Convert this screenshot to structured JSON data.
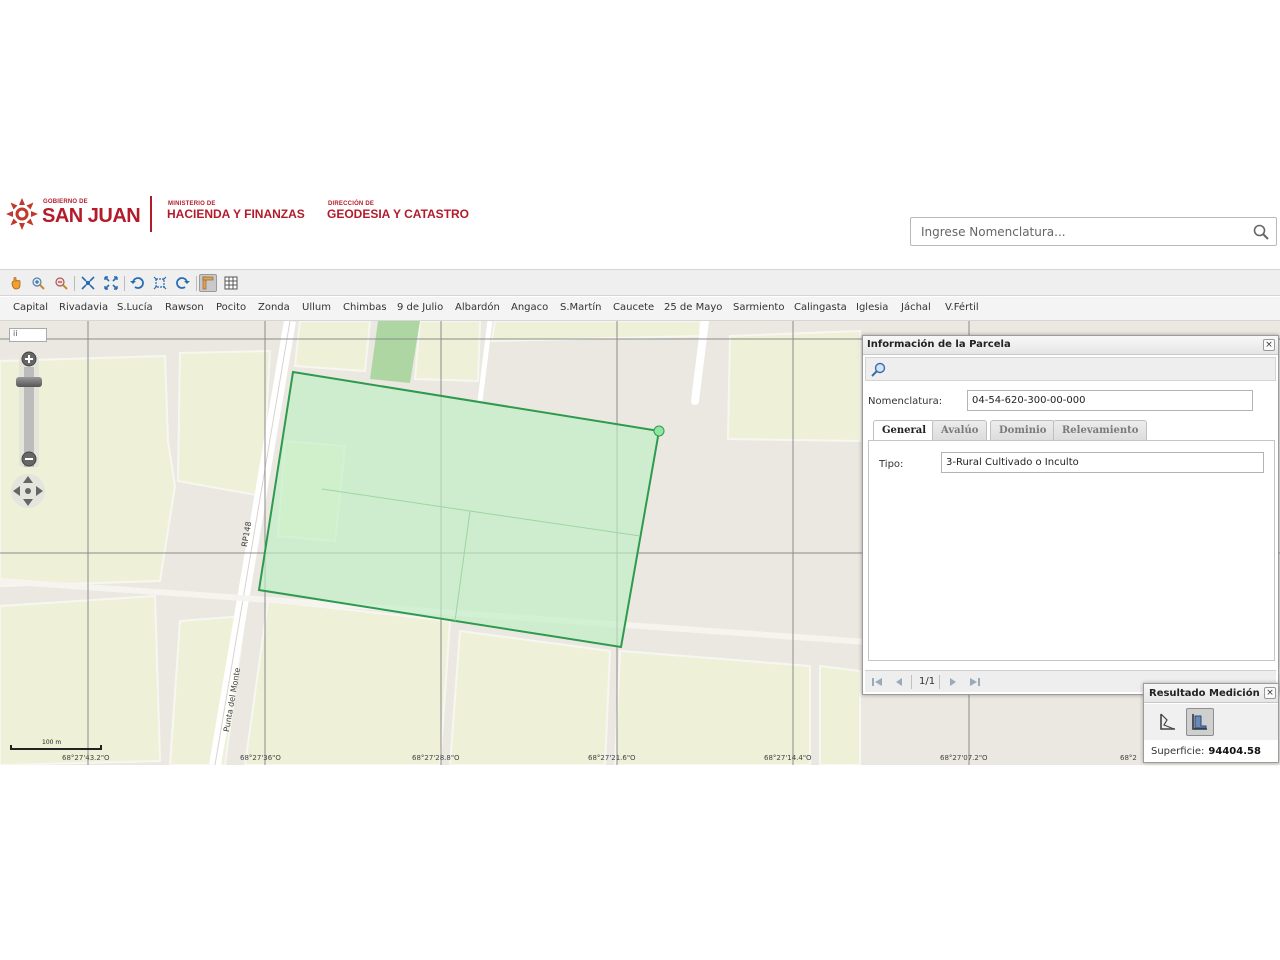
{
  "header": {
    "gov_small": "GOBIERNO DE",
    "gov_big": "SAN JUAN",
    "ministry_small": "MINISTERIO DE",
    "ministry_big": "HACIENDA Y FINANZAS",
    "direction_small": "DIRECCIÓN DE",
    "direction_big": "GEODESIA Y CATASTRO",
    "brand_color": "#b31b2b"
  },
  "search": {
    "placeholder": "Ingrese Nomenclatura...",
    "value": ""
  },
  "toolbar": {
    "icons": [
      "pan-hand-icon",
      "zoom-in-icon",
      "zoom-out-icon",
      "zoom-extent-icon",
      "zoom-full-icon",
      "undo-icon",
      "select-box-icon",
      "redo-icon",
      "measure-icon",
      "grid-icon"
    ]
  },
  "departments": [
    "Capital",
    "Rivadavia",
    "S.Lucía",
    "Rawson",
    "Pocito",
    "Zonda",
    "Ullum",
    "Chimbas",
    "9 de Julio",
    "Albardón",
    "Angaco",
    "S.Martín",
    "Caucete",
    "25 de Mayo",
    "Sarmiento",
    "Calingasta",
    "Iglesia",
    "Jáchal",
    "V.Fértil"
  ],
  "map": {
    "zoom_level": "ii",
    "road_label_1": "RP148",
    "road_label_2": "Punta del Monte",
    "scale_label": "100 m",
    "coordinates": [
      "68°27'43.2\"O",
      "68°27'36\"O",
      "68°27'28.8\"O",
      "68°27'21.6\"O",
      "68°27'14.4\"O",
      "68°27'07.2\"O",
      "68°2"
    ],
    "parcel_color": "#2e9a4e",
    "parcel_fill": "#bff0c4"
  },
  "info_panel": {
    "title": "Información de la Parcela",
    "close": "×",
    "nomenclatura_label": "Nomenclatura:",
    "nomenclatura_value": "04-54-620-300-00-000",
    "tabs": [
      "General",
      "Avalúo",
      "Dominio",
      "Relevamiento"
    ],
    "active_tab": "General",
    "tipo_label": "Tipo:",
    "tipo_value": "3-Rural Cultivado o Inculto",
    "pager": "1/1"
  },
  "measure_panel": {
    "title": "Resultado Medición",
    "close": "×",
    "result_label": "Superficie:",
    "result_value": "94404.58"
  }
}
